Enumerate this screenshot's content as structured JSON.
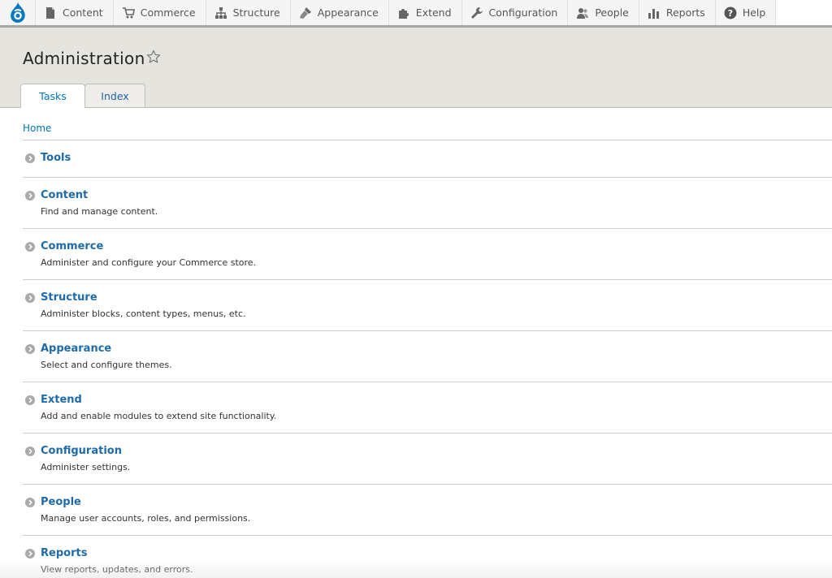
{
  "toolbar": {
    "items": [
      {
        "label": "Content",
        "icon": "file-icon"
      },
      {
        "label": "Commerce",
        "icon": "cart-icon"
      },
      {
        "label": "Structure",
        "icon": "sitemap-icon"
      },
      {
        "label": "Appearance",
        "icon": "brush-icon"
      },
      {
        "label": "Extend",
        "icon": "puzzle-icon"
      },
      {
        "label": "Configuration",
        "icon": "wrench-icon"
      },
      {
        "label": "People",
        "icon": "person-icon"
      },
      {
        "label": "Reports",
        "icon": "bar-chart-icon"
      },
      {
        "label": "Help",
        "icon": "question-icon"
      }
    ]
  },
  "header": {
    "title": "Administration",
    "tabs": [
      {
        "label": "Tasks",
        "active": true
      },
      {
        "label": "Index",
        "active": false
      }
    ]
  },
  "breadcrumb": "Home",
  "sections": [
    {
      "title": "Tools",
      "description": ""
    },
    {
      "title": "Content",
      "description": "Find and manage content."
    },
    {
      "title": "Commerce",
      "description": "Administer and configure your Commerce store."
    },
    {
      "title": "Structure",
      "description": "Administer blocks, content types, menus, etc."
    },
    {
      "title": "Appearance",
      "description": "Select and configure themes."
    },
    {
      "title": "Extend",
      "description": "Add and enable modules to extend site functionality."
    },
    {
      "title": "Configuration",
      "description": "Administer settings."
    },
    {
      "title": "People",
      "description": "Manage user accounts, roles, and permissions."
    },
    {
      "title": "Reports",
      "description": "View reports, updates, and errors."
    }
  ],
  "colors": {
    "link": "#1e6ba8",
    "header_bg": "#e6e4df",
    "toolbar_border": "#a7a7a7",
    "drupal_blue": "#0678be"
  }
}
